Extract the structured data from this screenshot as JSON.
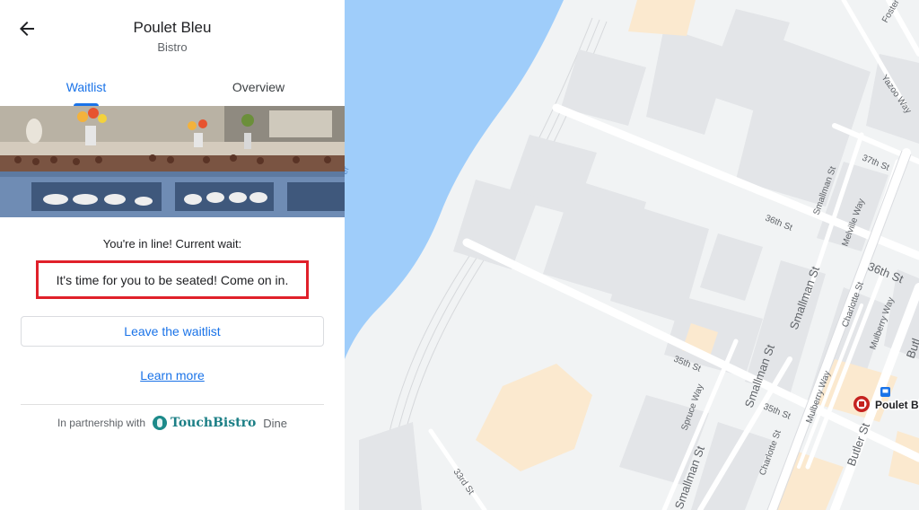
{
  "panel": {
    "place_name": "Poulet Bleu",
    "category": "Bistro",
    "tabs": [
      {
        "label": "Waitlist",
        "active": true
      },
      {
        "label": "Overview",
        "active": false
      }
    ],
    "wait_label": "You're in line! Current wait:",
    "seated_message": "It's time for you to be seated! Come on in.",
    "leave_button": "Leave the waitlist",
    "learn_more": "Learn more",
    "partner_prefix": "In partnership with",
    "partner_brand": "TouchBistro",
    "partner_suffix": "Dine"
  },
  "map": {
    "marker_label": "Poulet Bleu",
    "streets": {
      "foster": "Foster",
      "yazoo_way": "Yazoo Way",
      "s37": "37th St",
      "s36a": "36th St",
      "s36b": "36th St",
      "s35a": "35th St",
      "s35b": "35th St",
      "s33": "33rd St",
      "smallman_a": "Smallman St",
      "smallman_b": "Smallman St",
      "smallman_c": "Smallman St",
      "smallman_d": "Smallman St",
      "melville": "Melville Way",
      "charlotte_a": "Charlotte St",
      "charlotte_b": "Charlotte St",
      "mulberry_a": "Mulberry Way",
      "mulberry_b": "Mulberry Way",
      "spruce": "Spruce Way",
      "butler_a": "Butler St",
      "butler_b": "Butl",
      "river_fragment": "er"
    },
    "colors": {
      "water": "#9fcdfa",
      "land": "#f1f3f4",
      "block": "#e3e5e8",
      "road": "#ffffff",
      "sand": "#fbe9cf",
      "marker": "#c5221f"
    }
  }
}
